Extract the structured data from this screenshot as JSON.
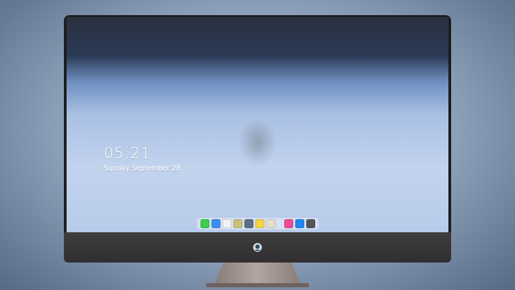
{
  "lock_screen": {
    "time": "05:21",
    "date": "Sunday September 28"
  },
  "dock": {
    "items": [
      {
        "kind": "app",
        "color": "#3ecf4f"
      },
      {
        "kind": "app",
        "color": "#3a8ef0"
      },
      {
        "kind": "app",
        "color": "#f2f2f2"
      },
      {
        "kind": "app",
        "color": "#c9c37a"
      },
      {
        "kind": "app",
        "color": "#5f6f82"
      },
      {
        "kind": "app",
        "color": "#f5d547"
      },
      {
        "kind": "app",
        "color": "#e6ddcc"
      },
      {
        "kind": "separator",
        "color": "#e8eef6"
      },
      {
        "kind": "app",
        "color": "#f04a9a"
      },
      {
        "kind": "app",
        "color": "#1e88f0"
      },
      {
        "kind": "app",
        "color": "#55555c"
      }
    ]
  }
}
